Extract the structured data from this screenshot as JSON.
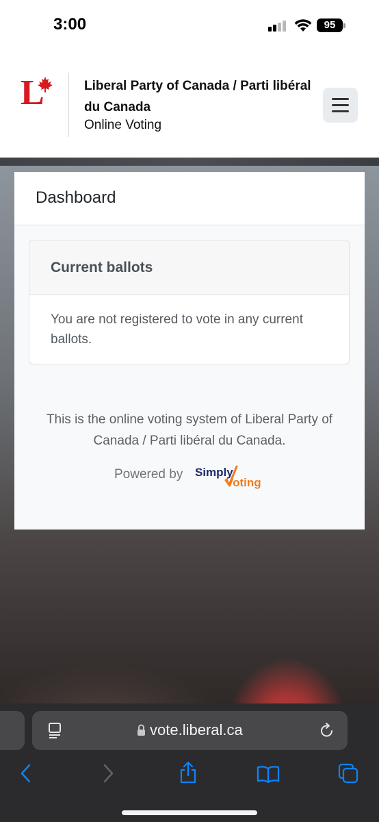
{
  "status_bar": {
    "time": "3:00",
    "battery": "95"
  },
  "header": {
    "title": "Liberal Party of Canada / Parti libéral du Canada",
    "subtitle": "Online Voting",
    "logo_color": "#d71920"
  },
  "dashboard": {
    "title": "Dashboard",
    "current_ballots": {
      "title": "Current ballots",
      "message": "You are not registered to vote in any current ballots."
    },
    "footer_text": "This is the online voting system of Liberal Party of Canada / Parti libéral du Canada.",
    "powered_by": "Powered by",
    "powered_logo": {
      "word1": "Simply",
      "word2": "Voting",
      "color1": "#1f2a6b",
      "color2": "#f07d1f"
    }
  },
  "browser": {
    "url": "vote.liberal.ca",
    "accent": "#0a84ff"
  }
}
